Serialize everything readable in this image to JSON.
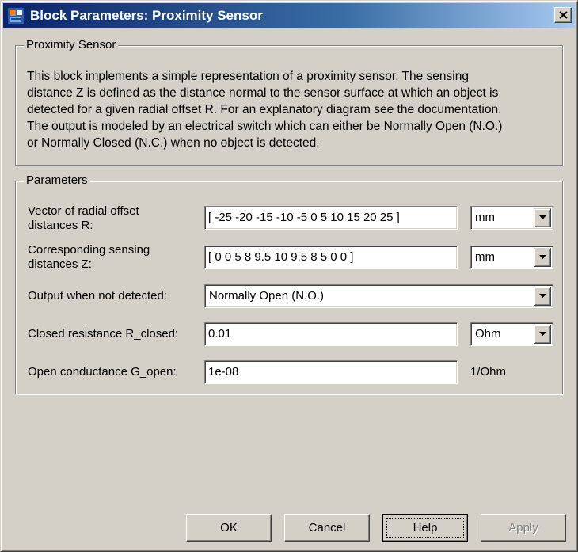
{
  "window": {
    "title": "Block Parameters: Proximity Sensor"
  },
  "description_group": {
    "title": "Proximity Sensor",
    "lines": [
      "This block implements a simple representation of a proximity sensor. The sensing",
      "distance Z is defined as the distance normal to the sensor surface at which an object is",
      "detected for a given radial offset R. For an explanatory diagram see the documentation.",
      "The output is modeled by an electrical switch which can either be Normally Open (N.O.)",
      "or Normally Closed (N.C.) when no object is detected."
    ]
  },
  "parameters": {
    "title": "Parameters",
    "radial_offset": {
      "label_line1": "Vector of radial offset",
      "label_line2": "distances R:",
      "value": "[ -25 -20 -15 -10 -5 0 5 10 15 20 25 ]",
      "unit": "mm"
    },
    "sensing_distances": {
      "label_line1": "Corresponding sensing",
      "label_line2": "distances Z:",
      "value": "[ 0 0 5 8 9.5 10 9.5 8 5 0 0 ]",
      "unit": "mm"
    },
    "output_not_detected": {
      "label": "Output when not detected:",
      "value": "Normally Open (N.O.)"
    },
    "closed_resistance": {
      "label": "Closed resistance R_closed:",
      "value": "0.01",
      "unit": "Ohm"
    },
    "open_conductance": {
      "label": "Open conductance G_open:",
      "value": "1e-08",
      "unit": "1/Ohm"
    }
  },
  "buttons": {
    "ok": "OK",
    "cancel": "Cancel",
    "help": "Help",
    "apply": "Apply"
  },
  "icons": {
    "app": "simulink-block-icon",
    "close": "close-icon",
    "dropdown": "chevron-down-icon"
  },
  "colors": {
    "title_bar_start": "#0a246a",
    "title_bar_end": "#a6caf0",
    "dialog_face": "#d4d0c8"
  }
}
